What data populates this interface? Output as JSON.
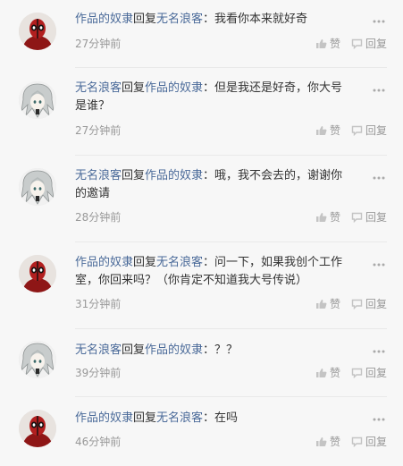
{
  "comments": [
    {
      "avatar_icon": "deadpool-avatar-icon",
      "author": "作品的奴隶",
      "reply_word": "回复",
      "target": "无名浪客",
      "text": "：我看你本来就好奇",
      "time": "27分钟前",
      "like_label": "赞",
      "reply_label": "回复"
    },
    {
      "avatar_icon": "anime-avatar-icon",
      "author": "无名浪客",
      "reply_word": "回复",
      "target": "作品的奴隶",
      "text": "：但是我还是好奇，你大号是谁？",
      "time": "27分钟前",
      "like_label": "赞",
      "reply_label": "回复"
    },
    {
      "avatar_icon": "anime-avatar-icon",
      "author": "无名浪客",
      "reply_word": "回复",
      "target": "作品的奴隶",
      "text": "：哦，我不会去的，谢谢你的邀请",
      "time": "28分钟前",
      "like_label": "赞",
      "reply_label": "回复"
    },
    {
      "avatar_icon": "deadpool-avatar-icon",
      "author": "作品的奴隶",
      "reply_word": "回复",
      "target": "无名浪客",
      "text": "：问一下，如果我创个工作室，你回来吗？（你肯定不知道我大号传说）",
      "time": "31分钟前",
      "like_label": "赞",
      "reply_label": "回复"
    },
    {
      "avatar_icon": "anime-avatar-icon",
      "author": "无名浪客",
      "reply_word": "回复",
      "target": "作品的奴隶",
      "text": "：？？",
      "time": "39分钟前",
      "like_label": "赞",
      "reply_label": "回复"
    },
    {
      "avatar_icon": "deadpool-avatar-icon",
      "author": "作品的奴隶",
      "reply_word": "回复",
      "target": "无名浪客",
      "text": "：在吗",
      "time": "46分钟前",
      "like_label": "赞",
      "reply_label": "回复"
    }
  ],
  "colors": {
    "name_link": "#4a6a99",
    "body_text": "#333333",
    "meta_text": "#999999",
    "background": "#f7f7f7"
  }
}
